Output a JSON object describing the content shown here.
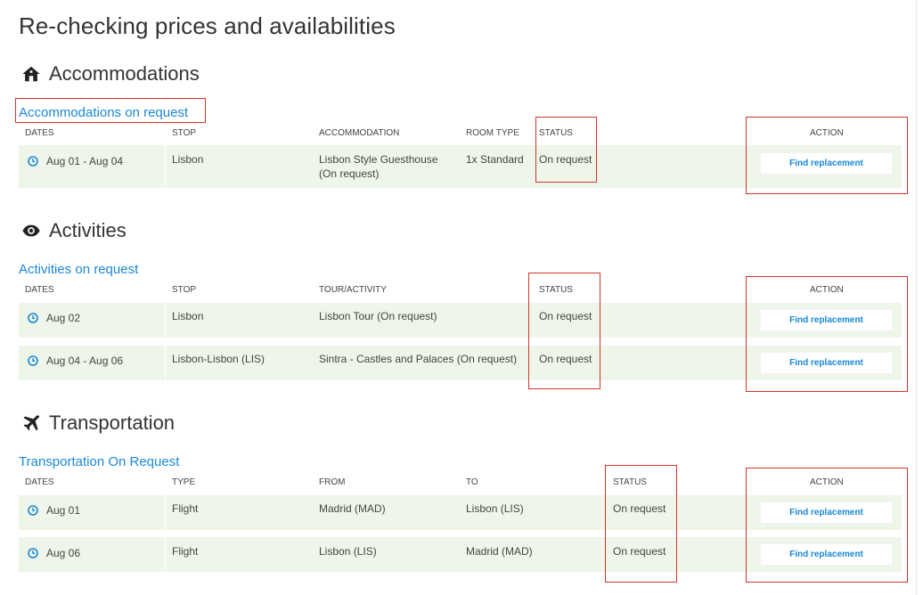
{
  "page": {
    "title": "Re-checking prices and availabilities"
  },
  "colors": {
    "link": "#1a88d8",
    "row_bg": "#eef6e9",
    "annotation": "#d0342c"
  },
  "accommodations": {
    "title": "Accommodations",
    "icon": "home-icon",
    "subheading": "Accommodations on request",
    "headers": {
      "dates": "DATES",
      "stop": "STOP",
      "accommodation": "ACCOMMODATION",
      "room_type": "ROOM TYPE",
      "status": "STATUS",
      "action": "ACTION"
    },
    "rows": [
      {
        "dates": "Aug 01 - Aug 04",
        "stop": "Lisbon",
        "accommodation_line1": "Lisbon Style Guesthouse",
        "accommodation_line2": "(On request)",
        "room_type": "1x Standard",
        "status": "On request",
        "action": "Find replacement"
      }
    ]
  },
  "activities": {
    "title": "Activities",
    "icon": "eye-icon",
    "subheading": "Activities on request",
    "headers": {
      "dates": "DATES",
      "stop": "STOP",
      "tour": "TOUR/ACTIVITY",
      "status": "STATUS",
      "action": "ACTION"
    },
    "rows": [
      {
        "dates": "Aug 02",
        "stop": "Lisbon",
        "tour": "Lisbon Tour (On request)",
        "status": "On request",
        "action": "Find replacement"
      },
      {
        "dates": "Aug 04 - Aug 06",
        "stop": "Lisbon-Lisbon (LIS)",
        "tour": "Sintra - Castles and Palaces (On request)",
        "status": "On request",
        "action": "Find replacement"
      }
    ]
  },
  "transportation": {
    "title": "Transportation",
    "icon": "plane-icon",
    "subheading": "Transportation On Request",
    "headers": {
      "dates": "DATES",
      "type": "TYPE",
      "from": "FROM",
      "to": "TO",
      "status": "STATUS",
      "action": "ACTION"
    },
    "rows": [
      {
        "dates": "Aug 01",
        "type": "Flight",
        "from": "Madrid (MAD)",
        "to": "Lisbon (LIS)",
        "status": "On request",
        "action": "Find replacement"
      },
      {
        "dates": "Aug 06",
        "type": "Flight",
        "from": "Lisbon (LIS)",
        "to": "Madrid (MAD)",
        "status": "On request",
        "action": "Find replacement"
      }
    ]
  }
}
